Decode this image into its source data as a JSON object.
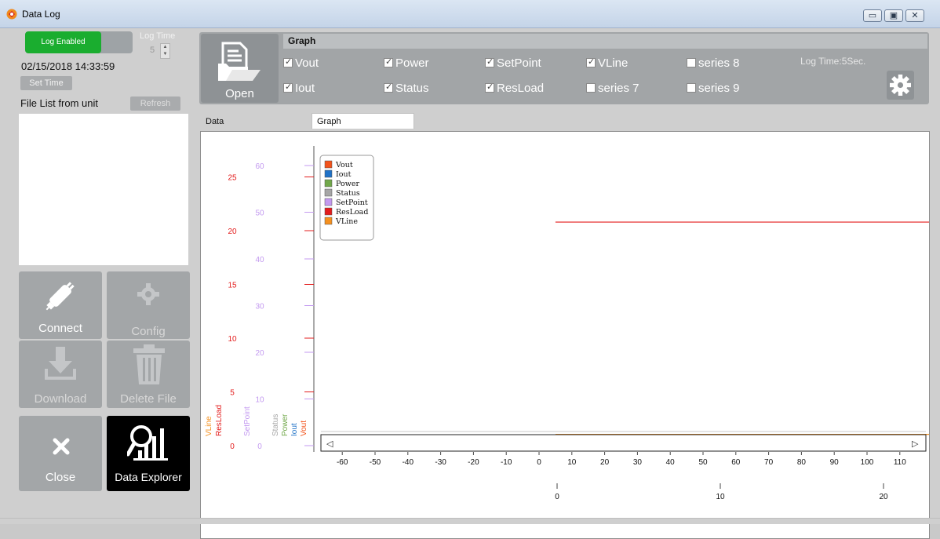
{
  "window": {
    "title": "Data Log"
  },
  "left": {
    "log_toggle": "Log Enabled",
    "log_time_label": "Log Time",
    "log_time_value": "5",
    "datetime": "02/15/2018 14:33:59",
    "set_time": "Set Time",
    "file_list_label": "File List from unit",
    "refresh": "Refresh",
    "tiles": {
      "connect": "Connect",
      "config": "Config",
      "download": "Download",
      "delete": "Delete File",
      "close": "Close",
      "explorer": "Data Explorer"
    }
  },
  "toolbar": {
    "open": "Open",
    "group_title": "Graph",
    "log_time_display": "Log Time:5Sec.",
    "checkboxes": [
      {
        "label": "Vout",
        "checked": true
      },
      {
        "label": "Power",
        "checked": true
      },
      {
        "label": "SetPoint",
        "checked": true
      },
      {
        "label": "VLine",
        "checked": true
      },
      {
        "label": "series 8",
        "checked": false
      },
      {
        "label": "Iout",
        "checked": true
      },
      {
        "label": "Status",
        "checked": true
      },
      {
        "label": "ResLoad",
        "checked": true
      },
      {
        "label": "series 7",
        "checked": false
      },
      {
        "label": "series 9",
        "checked": false
      }
    ]
  },
  "tabs": {
    "data": "Data",
    "graph": "Graph"
  },
  "chart_data": {
    "type": "line",
    "legend": [
      "Vout",
      "Iout",
      "Power",
      "Status",
      "SetPoint",
      "ResLoad",
      "VLine"
    ],
    "legend_colors": {
      "Vout": "#f2531b",
      "Iout": "#1f72c7",
      "Power": "#71a84a",
      "Status": "#a6a6a6",
      "SetPoint": "#c39af0",
      "ResLoad": "#e31c1c",
      "VLine": "#f5901e"
    },
    "legend_position": "top-left",
    "y_axis_titles": [
      "VLine",
      "ResLoad",
      "SetPoint",
      "Status",
      "Power",
      "Iout",
      "Vout"
    ],
    "resload_axis": {
      "ticks": [
        0,
        5,
        10,
        15,
        20,
        25
      ],
      "color": "#e31c1c"
    },
    "setpoint_axis": {
      "ticks": [
        0,
        10,
        20,
        30,
        40,
        50,
        60
      ],
      "color": "#c39af0"
    },
    "x_ticks_seconds": [
      -60,
      -50,
      -40,
      -30,
      -20,
      -10,
      0,
      10,
      20,
      30,
      40,
      50,
      60,
      70,
      80,
      90,
      100,
      110
    ],
    "x_ticks_minutes": [
      0,
      10,
      20
    ],
    "series": [
      {
        "name": "ResLoad",
        "x_start": 5,
        "x_end": 117,
        "y": 20.8
      },
      {
        "name": "VLine",
        "x_start": 5,
        "x_end": 117,
        "y": 0.1
      }
    ]
  }
}
